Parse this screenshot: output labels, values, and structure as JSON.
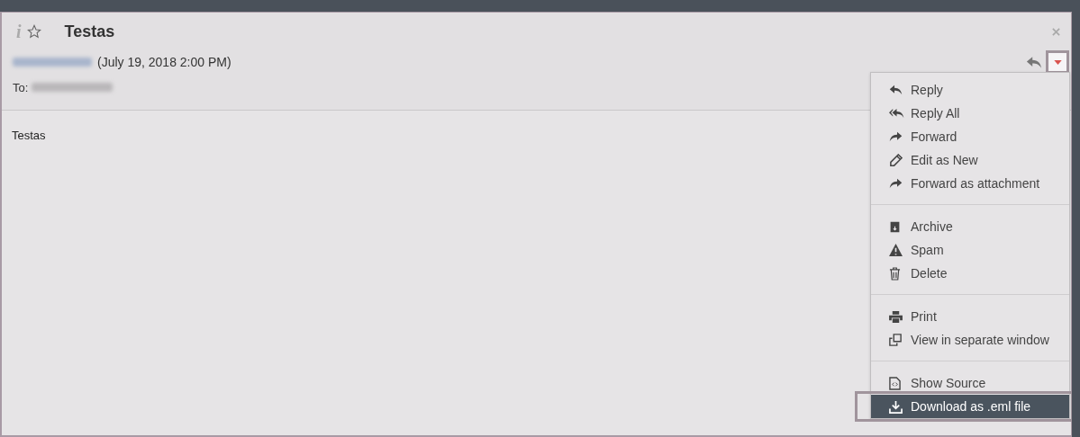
{
  "message": {
    "info_icon": "i",
    "subject": "Testas",
    "date": "(July 19, 2018 2:00 PM)",
    "to_label": "To:",
    "body": "Testas",
    "flagged": false
  },
  "menu": {
    "open": true,
    "groups": [
      [
        {
          "label": "Reply",
          "kind": "reply",
          "selected": false
        },
        {
          "label": "Reply All",
          "kind": "replyall",
          "selected": false
        },
        {
          "label": "Forward",
          "kind": "forward",
          "selected": false
        },
        {
          "label": "Edit as New",
          "kind": "edit",
          "selected": false
        },
        {
          "label": "Forward as attachment",
          "kind": "forward",
          "selected": false
        }
      ],
      [
        {
          "label": "Archive",
          "kind": "archive",
          "selected": false
        },
        {
          "label": "Spam",
          "kind": "spam",
          "selected": false
        },
        {
          "label": "Delete",
          "kind": "delete",
          "selected": false
        }
      ],
      [
        {
          "label": "Print",
          "kind": "print",
          "selected": false
        },
        {
          "label": "View in separate window",
          "kind": "window",
          "selected": false
        }
      ],
      [
        {
          "label": "Show Source",
          "kind": "source",
          "selected": false
        },
        {
          "label": "Download as .eml file",
          "kind": "download",
          "selected": true
        }
      ]
    ]
  }
}
